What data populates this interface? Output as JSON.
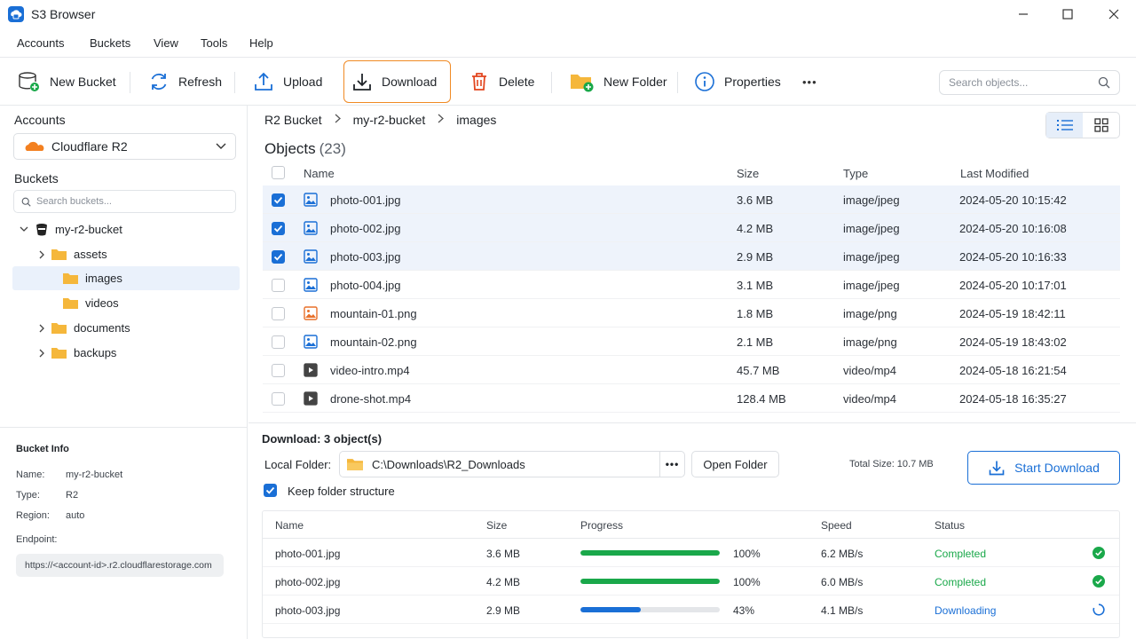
{
  "app": {
    "title": "S3 Browser"
  },
  "menu": [
    "Accounts",
    "Buckets",
    "View",
    "Tools",
    "Help"
  ],
  "toolbar": {
    "new_bucket": "New Bucket",
    "refresh": "Refresh",
    "upload": "Upload",
    "download": "Download",
    "delete": "Delete",
    "new_folder": "New Folder",
    "properties": "Properties",
    "more": "•••",
    "search_placeholder": "Search objects..."
  },
  "sidebar": {
    "accounts_heading": "Accounts",
    "account_selected": "Cloudflare R2",
    "buckets_heading": "Buckets",
    "bucket_search_placeholder": "Search buckets...",
    "tree": [
      {
        "label": "my-r2-bucket"
      },
      {
        "label": "assets"
      },
      {
        "label": "images"
      },
      {
        "label": "videos"
      },
      {
        "label": "documents"
      },
      {
        "label": "backups"
      }
    ],
    "bucket_info": {
      "title": "Bucket Info",
      "name_key": "Name:",
      "name_val": "my-r2-bucket",
      "type_key": "Type:",
      "type_val": "R2",
      "region_key": "Region:",
      "region_val": "auto",
      "endpoint_key": "Endpoint:",
      "endpoint_val": "https://<account-id>.r2.cloudflarestorage.com"
    }
  },
  "breadcrumb": [
    "R2 Bucket",
    "my-r2-bucket",
    "images"
  ],
  "objects": {
    "title": "Objects",
    "count": "(23)",
    "columns": {
      "name": "Name",
      "size": "Size",
      "type": "Type",
      "modified": "Last Modified"
    },
    "rows": [
      {
        "name": "photo-001.jpg",
        "size": "3.6 MB",
        "type": "image/jpeg",
        "modified": "2024-05-20 10:15:42",
        "checked": true,
        "kind": "image"
      },
      {
        "name": "photo-002.jpg",
        "size": "4.2 MB",
        "type": "image/jpeg",
        "modified": "2024-05-20 10:16:08",
        "checked": true,
        "kind": "image"
      },
      {
        "name": "photo-003.jpg",
        "size": "2.9 MB",
        "type": "image/jpeg",
        "modified": "2024-05-20 10:16:33",
        "checked": true,
        "kind": "image"
      },
      {
        "name": "photo-004.jpg",
        "size": "3.1 MB",
        "type": "image/jpeg",
        "modified": "2024-05-20 10:17:01",
        "checked": false,
        "kind": "image"
      },
      {
        "name": "mountain-01.png",
        "size": "1.8 MB",
        "type": "image/png",
        "modified": "2024-05-19 18:42:11",
        "checked": false,
        "kind": "image-orange"
      },
      {
        "name": "mountain-02.png",
        "size": "2.1 MB",
        "type": "image/png",
        "modified": "2024-05-19 18:43:02",
        "checked": false,
        "kind": "image"
      },
      {
        "name": "video-intro.mp4",
        "size": "45.7 MB",
        "type": "video/mp4",
        "modified": "2024-05-18 16:21:54",
        "checked": false,
        "kind": "video"
      },
      {
        "name": "drone-shot.mp4",
        "size": "128.4 MB",
        "type": "video/mp4",
        "modified": "2024-05-18 16:35:27",
        "checked": false,
        "kind": "video"
      }
    ]
  },
  "download": {
    "title": "Download: 3 object(s)",
    "local_folder_label": "Local Folder:",
    "local_folder_path": "C:\\Downloads\\R2_Downloads",
    "more": "•••",
    "open_folder": "Open Folder",
    "total_size": "Total Size: 10.7 MB",
    "start_download": "Start Download",
    "keep_structure": "Keep folder structure",
    "columns": {
      "name": "Name",
      "size": "Size",
      "progress": "Progress",
      "speed": "Speed",
      "status": "Status"
    },
    "rows": [
      {
        "name": "photo-001.jpg",
        "size": "3.6 MB",
        "progress": 100,
        "progress_text": "100%",
        "speed": "6.2 MB/s",
        "status": "Completed"
      },
      {
        "name": "photo-002.jpg",
        "size": "4.2 MB",
        "progress": 100,
        "progress_text": "100%",
        "speed": "6.0 MB/s",
        "status": "Completed"
      },
      {
        "name": "photo-003.jpg",
        "size": "2.9 MB",
        "progress": 43,
        "progress_text": "43%",
        "speed": "4.1 MB/s",
        "status": "Downloading"
      }
    ]
  },
  "colors": {
    "accent": "#1a6fd6",
    "active_outline": "#f08a24",
    "complete": "#1aa84a",
    "progress_active": "#1a6fd6",
    "folder": "#f5b73b"
  }
}
